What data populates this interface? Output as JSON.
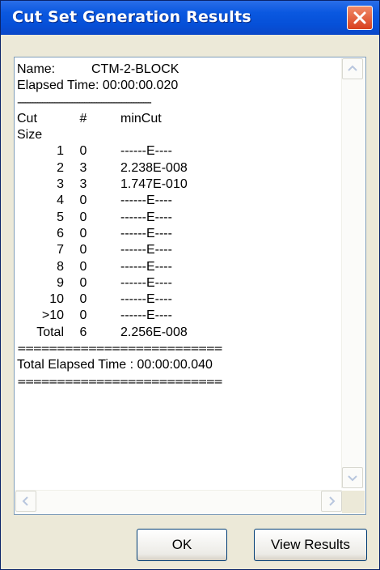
{
  "window": {
    "title": "Cut Set Generation Results"
  },
  "results": {
    "name_label": "Name:",
    "name_value": "CTM-2-BLOCK",
    "elapsed": "Elapsed Time: 00:00:00.020",
    "separator_dashes": "------------------------------------------------------",
    "header": {
      "col1": "Cut",
      "col2": "#",
      "col3": "minCut"
    },
    "header_line2": "Size",
    "rows": [
      {
        "size": "1",
        "count": "0",
        "mincut": "------E----"
      },
      {
        "size": "2",
        "count": "3",
        "mincut": "2.238E-008"
      },
      {
        "size": "3",
        "count": "3",
        "mincut": "1.747E-010"
      },
      {
        "size": "4",
        "count": "0",
        "mincut": "------E----"
      },
      {
        "size": "5",
        "count": "0",
        "mincut": "------E----"
      },
      {
        "size": "6",
        "count": "0",
        "mincut": "------E----"
      },
      {
        "size": "7",
        "count": "0",
        "mincut": "------E----"
      },
      {
        "size": "8",
        "count": "0",
        "mincut": "------E----"
      },
      {
        "size": "9",
        "count": "0",
        "mincut": "------E----"
      },
      {
        "size": "10",
        "count": "0",
        "mincut": "------E----"
      },
      {
        "size": ">10",
        "count": "0",
        "mincut": "------E----"
      },
      {
        "size": "Total",
        "count": "6",
        "mincut": "2.256E-008"
      }
    ],
    "separator_equals": "==========================",
    "total_elapsed": "Total Elapsed Time : 00:00:00.040"
  },
  "buttons": {
    "ok": "OK",
    "view_results": "View Results"
  },
  "icons": {
    "close": "close-icon",
    "scroll_up": "arrow-up-icon",
    "scroll_down": "arrow-down-icon",
    "scroll_left": "arrow-left-icon",
    "scroll_right": "arrow-right-icon"
  },
  "colors": {
    "titlebar": "#0a58e0",
    "close_button": "#d8401e",
    "dialog_background": "#ece9d8"
  }
}
